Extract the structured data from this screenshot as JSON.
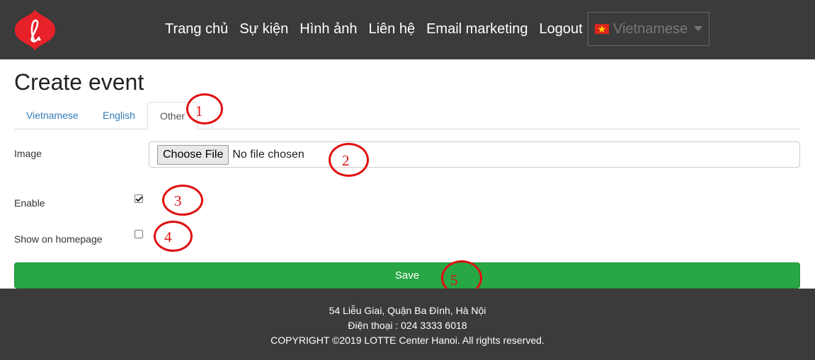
{
  "nav": {
    "links": [
      "Trang chủ",
      "Sự kiện",
      "Hình ảnh",
      "Liên hệ",
      "Email marketing",
      "Logout"
    ],
    "language": "Vietnamese",
    "brand_color": "#e62129"
  },
  "page": {
    "title": "Create event",
    "tabs": [
      "Vietnamese",
      "English",
      "Other"
    ],
    "active_tab": "Other"
  },
  "form": {
    "image_label": "Image",
    "choose_file_label": "Choose File",
    "no_file_text": "No file chosen",
    "enable_label": "Enable",
    "enable_checked": true,
    "homepage_label": "Show on homepage",
    "homepage_checked": false,
    "save_label": "Save",
    "save_color": "#28a745"
  },
  "annotations": [
    "1",
    "2",
    "3",
    "4",
    "5"
  ],
  "footer": {
    "address": "54 Liễu Giai, Quận Ba Đình, Hà Nội",
    "phone": "Điện thoại : 024 3333 6018",
    "copyright": "COPYRIGHT ©2019 LOTTE Center Hanoi. All rights reserved."
  }
}
